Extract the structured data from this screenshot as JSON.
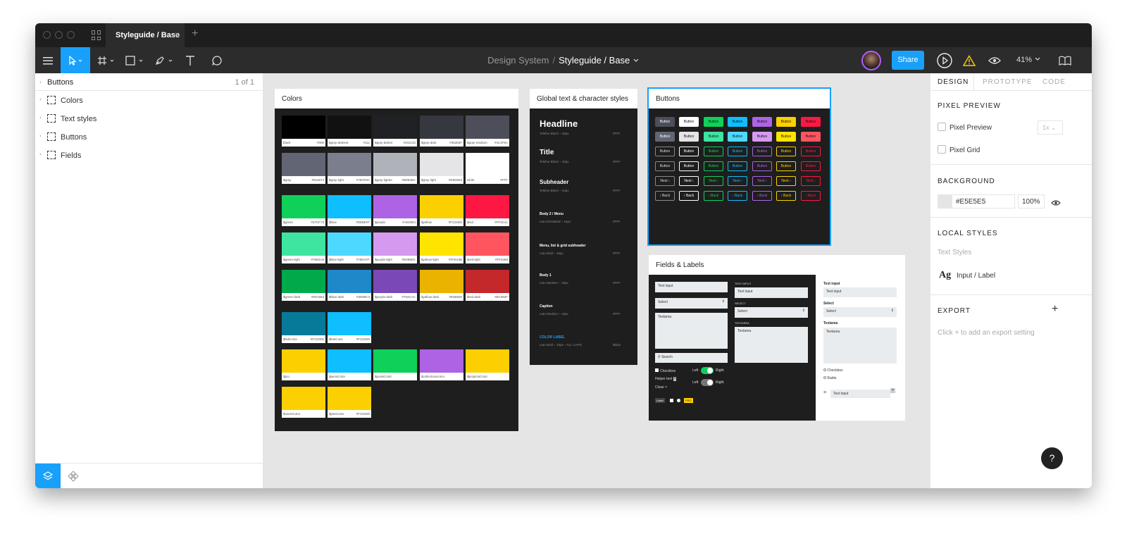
{
  "tabbar": {
    "tab_title": "Styleguide / Base",
    "close_glyph": "×",
    "add_glyph": "+"
  },
  "toolbar": {
    "breadcrumb_project": "Design System",
    "breadcrumb_sep": "/",
    "breadcrumb_file": "Styleguide / Base",
    "share_label": "Share",
    "zoom_label": "41%"
  },
  "left_panel": {
    "page_name": "Buttons",
    "page_count": "1 of 1",
    "layers": [
      {
        "label": "Colors"
      },
      {
        "label": "Text styles"
      },
      {
        "label": "Buttons"
      },
      {
        "label": "Fields"
      }
    ]
  },
  "right_panel": {
    "tabs": [
      "DESIGN",
      "PROTOTYPE",
      "CODE"
    ],
    "pixel_preview_title": "PIXEL PREVIEW",
    "pixel_preview_label": "Pixel Preview",
    "pixel_preview_select": "1x",
    "pixel_grid_label": "Pixel Grid",
    "background_title": "BACKGROUND",
    "background_hex": "#E5E5E5",
    "background_opacity": "100%",
    "local_styles_title": "LOCAL STYLES",
    "text_styles_label": "Text Styles",
    "style_glyph": "Ag",
    "style_name": "Input / Label",
    "export_title": "EXPORT",
    "export_hint": "Click + to add an export setting",
    "add_glyph": "+"
  },
  "help_glyph": "?",
  "colors_frame": {
    "title": "Colors",
    "swatches": [
      {
        "name": "black",
        "hex": "#000",
        "color": "#000000"
      },
      {
        "name": "$gray-darkest",
        "hex": "#111",
        "color": "#111111"
      },
      {
        "name": "$gray-darker",
        "hex": "#202125",
        "color": "#202125"
      },
      {
        "name": "$gray-dark",
        "hex": "#36383F",
        "color": "#36383F"
      },
      {
        "name": "$gray-medium",
        "hex": "#4C4F5A",
        "color": "#4C4F5A"
      },
      {
        "name": "$gray",
        "hex": "#616574",
        "color": "#616574"
      },
      {
        "name": "$gray-light",
        "hex": "#7B7E8C",
        "color": "#7B7E8C"
      },
      {
        "name": "$gray-lighter",
        "hex": "#B0B2BA",
        "color": "#B0B2BA"
      },
      {
        "name": "$gray-light",
        "hex": "#E5E5E8",
        "color": "#E5E5E8"
      },
      {
        "name": "white",
        "hex": "#FFF",
        "color": "#FFFFFF"
      },
      {
        "name": "$green",
        "hex": "#47CF73",
        "color": "#0FD15A"
      },
      {
        "name": "$blue",
        "hex": "#0EBEFF",
        "color": "#0EBEFF"
      },
      {
        "name": "$purple",
        "hex": "#AE63E4",
        "color": "#AE63E4"
      },
      {
        "name": "$yellow",
        "hex": "#FCD000",
        "color": "#FCD000"
      },
      {
        "name": "$red",
        "hex": "#FF3C41",
        "color": "#FF1744"
      },
      {
        "name": "$green-light",
        "hex": "#76E5A6",
        "color": "#3FE4A0"
      },
      {
        "name": "$blue-light",
        "hex": "#76DAFF",
        "color": "#4DD9FF"
      },
      {
        "name": "$purple-light",
        "hex": "#D098EC",
        "color": "#D59AF0"
      },
      {
        "name": "$yellow-light",
        "hex": "#FFE34B",
        "color": "#FFE400"
      },
      {
        "name": "$red-light",
        "hex": "#FF6468",
        "color": "#FF5560"
      },
      {
        "name": "$green-dark",
        "hex": "#00A953",
        "color": "#00A94A"
      },
      {
        "name": "$blue-dark",
        "hex": "#3D88C3",
        "color": "#1E88C9"
      },
      {
        "name": "$purple-dark",
        "hex": "#754CAC",
        "color": "#7B48B8"
      },
      {
        "name": "$yellow-dark",
        "hex": "#E5B600",
        "color": "#EAB300"
      },
      {
        "name": "$red-dark",
        "hex": "#BA382F",
        "color": "#C5282A"
      },
      {
        "name": "$linkColor",
        "hex": "#FCD000",
        "color": "#087A99"
      },
      {
        "name": "$linkColor",
        "hex": "#FCD000",
        "color": "#0EBEFF"
      },
      {
        "name": "$pro",
        "hex": "",
        "color": "#FCD000"
      },
      {
        "name": "$pensColor",
        "hex": "",
        "color": "#0EBEFF"
      },
      {
        "name": "$postsColor",
        "hex": "",
        "color": "#0FD15A"
      },
      {
        "name": "$collectionscolor",
        "hex": "",
        "color": "#AE63E4"
      },
      {
        "name": "$projectsColor",
        "hex": "",
        "color": "#FCD000"
      },
      {
        "name": "$usersColor",
        "hex": "",
        "color": "#FCD000"
      },
      {
        "name": "$jobsColor",
        "hex": "#FCD000",
        "color": "#FCD000"
      }
    ]
  },
  "text_frame": {
    "title": "Global text & character styles",
    "styles": [
      {
        "sample": "Headline",
        "meta": "Telefon Black – 45px",
        "value": "#FFF"
      },
      {
        "sample": "Title",
        "meta": "Telefon Black – 32px",
        "value": "#FFF"
      },
      {
        "sample": "Subheader",
        "meta": "Telefon Black – 24px",
        "value": "#FFF"
      },
      {
        "sample": "Body 2 / Menu",
        "meta": "Lato ExtraBold – 16px",
        "value": "#FFF"
      },
      {
        "sample": "Menu, list & grid subheader",
        "meta": "Lato Bold – 15px",
        "value": "#FFF"
      },
      {
        "sample": "Body 1",
        "meta": "Lato Medium – 15px",
        "value": "#FFF"
      },
      {
        "sample": "Caption",
        "meta": "Lato Medium – 13px",
        "value": "#FFF"
      },
      {
        "sample": "COLOR LABEL",
        "meta": "Lato Bold – 15px – ALL CAPS",
        "value": "$blue"
      }
    ]
  },
  "buttons_frame": {
    "title": "Buttons",
    "labels": [
      "Button",
      "Button",
      "Button",
      "Button",
      "Next",
      "‹ Back"
    ],
    "colors": [
      "#4C4F5A",
      "#FFFFFF",
      "#0FD15A",
      "#0EBEFF",
      "#AE63E4",
      "#FCD000",
      "#FF1744"
    ],
    "colors_alt": [
      "#616574",
      "#E5E5E8",
      "#3FE4A0",
      "#4DD9FF",
      "#D59AF0",
      "#FFE400",
      "#FF5560"
    ]
  },
  "fields_frame": {
    "title": "Fields & Labels",
    "text_input": "Text input",
    "select": "Select",
    "textarea": "Textarea",
    "search": "Search",
    "checkbox": "Checkbox",
    "helper_text": "Helper text",
    "close": "Close",
    "left": "Left",
    "right": "Right",
    "label": "Label",
    "pro": "PRO",
    "text_input_caps": "TEXT INPUT",
    "select_caps": "SELECT",
    "textarea_caps": "TEXTAREA",
    "radio": "Radio"
  }
}
